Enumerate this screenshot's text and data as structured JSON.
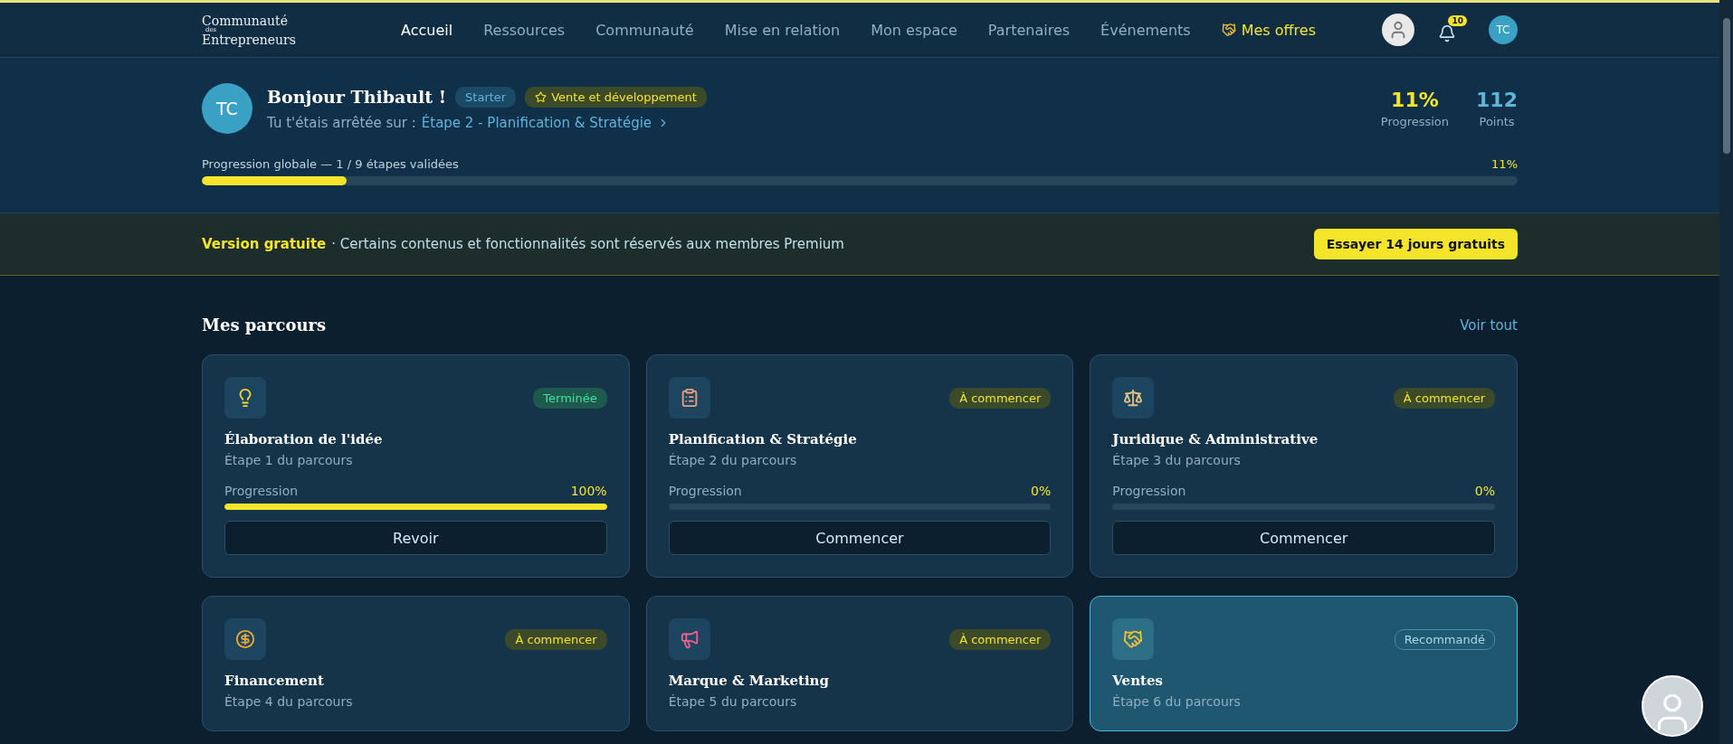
{
  "nav": {
    "logo": {
      "top": "Communauté",
      "small": "des",
      "bottom": "Entrepreneurs"
    },
    "items": [
      {
        "label": "Accueil",
        "selected": true,
        "kind": "link"
      },
      {
        "label": "Ressources",
        "selected": false,
        "kind": "link"
      },
      {
        "label": "Communauté",
        "selected": false,
        "kind": "link"
      },
      {
        "label": "Mise en relation",
        "selected": false,
        "kind": "link"
      },
      {
        "label": "Mon espace",
        "selected": false,
        "kind": "link"
      },
      {
        "label": "Partenaires",
        "selected": false,
        "kind": "link"
      },
      {
        "label": "Événements",
        "selected": false,
        "kind": "link"
      },
      {
        "label": "Mes offres",
        "selected": false,
        "kind": "offer"
      }
    ],
    "notifications": "10",
    "user_initials": "TC"
  },
  "hero": {
    "initials": "TC",
    "greeting": "Bonjour Thibault !",
    "plan": "Starter",
    "track": "Vente et développement",
    "resume_prefix": "Tu t'étais arrêtée sur :",
    "resume_link": "Étape 2 - Planification & Stratégie",
    "stats": [
      {
        "value": "11%",
        "label": "Progression",
        "kind": "progress"
      },
      {
        "value": "112",
        "label": "Points",
        "kind": "points"
      }
    ],
    "overall_label": "Progression globale — 1 / 9 étapes validées",
    "overall_value": "11%",
    "level": 0.11
  },
  "banner": {
    "title": "Version gratuite",
    "text": "· Certains contenus et fonctionnalités sont réservés aux membres Premium",
    "button": "Essayer 14 jours gratuits"
  },
  "section": {
    "title": "Mes parcours",
    "link": "Voir tout"
  },
  "cards": [
    {
      "kind": "idea",
      "status": "Terminée",
      "completed": true,
      "recommended": false,
      "title": "Élaboration de l'idée",
      "subtitle": "Étape 1 du parcours",
      "highlighted": false,
      "progress": {
        "label": "Progression",
        "value": "100%",
        "level": 1
      },
      "button": "Revoir"
    },
    {
      "kind": "planning",
      "status": "À commencer",
      "completed": false,
      "recommended": false,
      "title": "Planification & Stratégie",
      "subtitle": "Étape 2 du parcours",
      "highlighted": false,
      "progress": {
        "label": "Progression",
        "value": "0%",
        "level": 0
      },
      "button": "Commencer"
    },
    {
      "kind": "legal",
      "status": "À commencer",
      "completed": false,
      "recommended": false,
      "title": "Juridique & Administrative",
      "subtitle": "Étape 3 du parcours",
      "highlighted": false,
      "progress": {
        "label": "Progression",
        "value": "0%",
        "level": 0
      },
      "button": "Commencer"
    },
    {
      "kind": "finance",
      "status": "À commencer",
      "completed": false,
      "recommended": false,
      "title": "Financement",
      "subtitle": "Étape 4 du parcours",
      "highlighted": false
    },
    {
      "kind": "marketing",
      "status": "À commencer",
      "completed": false,
      "recommended": false,
      "title": "Marque & Marketing",
      "subtitle": "Étape 5 du parcours",
      "highlighted": false
    },
    {
      "kind": "sales",
      "status": "Recommandé",
      "completed": false,
      "recommended": true,
      "title": "Ventes",
      "subtitle": "Étape 6 du parcours",
      "highlighted": true
    }
  ]
}
